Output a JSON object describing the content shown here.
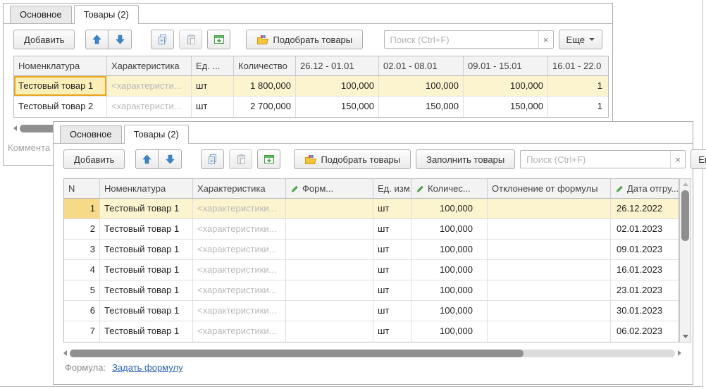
{
  "colors": {
    "selection_row": "#fcf3cf",
    "selection_focus_border": "#e9a51e",
    "selection_number_cell": "#f6da88",
    "link_blue": "#2c63b8",
    "move_arrow_blue": "#3d85c8",
    "pencil_green": "#52a852"
  },
  "back_window": {
    "tabs": [
      {
        "label": "Основное"
      },
      {
        "label": "Товары (2)"
      }
    ],
    "toolbar": {
      "add_label": "Добавить",
      "pick_label": "Подобрать товары",
      "search_placeholder": "Поиск (Ctrl+F)",
      "clear_glyph": "×",
      "more_label": "Еще"
    },
    "columns": [
      "Номенклатура",
      "Характеристика",
      "Ед. ...",
      "Количество",
      "26.12 - 01.01",
      "02.01 - 08.01",
      "09.01 - 15.01",
      "16.01 - 22.0"
    ],
    "rows": [
      {
        "name": "Тестовый товар 1",
        "characteristic": "<характеристи...",
        "unit": "шт",
        "qty": "1 800,000",
        "w1": "100,000",
        "w2": "100,000",
        "w3": "100,000",
        "w4": "1"
      },
      {
        "name": "Тестовый товар 2",
        "characteristic": "<характеристи...",
        "unit": "шт",
        "qty": "2 700,000",
        "w1": "150,000",
        "w2": "150,000",
        "w3": "150,000",
        "w4": "1"
      }
    ],
    "comment_label": "Коммента"
  },
  "front_window": {
    "tabs": [
      {
        "label": "Основное"
      },
      {
        "label": "Товары (2)"
      }
    ],
    "toolbar": {
      "add_label": "Добавить",
      "pick_label": "Подобрать товары",
      "fill_label": "Заполнить товары",
      "search_placeholder": "Поиск (Ctrl+F)",
      "clear_glyph": "×",
      "more_label": "Еще"
    },
    "columns": [
      "N",
      "Номенклатура",
      "Характеристика",
      "Форм...",
      "Ед. изм.",
      "Количес...",
      "Отклонение от формулы",
      "Дата отгру..."
    ],
    "rows": [
      {
        "n": "1",
        "name": "Тестовый товар 1",
        "characteristic": "<характеристики...",
        "formula": "",
        "unit": "шт",
        "qty": "100,000",
        "deviation": "",
        "date": "26.12.2022"
      },
      {
        "n": "2",
        "name": "Тестовый товар 1",
        "characteristic": "<характеристики...",
        "formula": "",
        "unit": "шт",
        "qty": "100,000",
        "deviation": "",
        "date": "02.01.2023"
      },
      {
        "n": "3",
        "name": "Тестовый товар 1",
        "characteristic": "<характеристики...",
        "formula": "",
        "unit": "шт",
        "qty": "100,000",
        "deviation": "",
        "date": "09.01.2023"
      },
      {
        "n": "4",
        "name": "Тестовый товар 1",
        "characteristic": "<характеристики...",
        "formula": "",
        "unit": "шт",
        "qty": "100,000",
        "deviation": "",
        "date": "16.01.2023"
      },
      {
        "n": "5",
        "name": "Тестовый товар 1",
        "characteristic": "<характеристики...",
        "formula": "",
        "unit": "шт",
        "qty": "100,000",
        "deviation": "",
        "date": "23.01.2023"
      },
      {
        "n": "6",
        "name": "Тестовый товар 1",
        "characteristic": "<характеристики...",
        "formula": "",
        "unit": "шт",
        "qty": "100,000",
        "deviation": "",
        "date": "30.01.2023"
      },
      {
        "n": "7",
        "name": "Тестовый товар 1",
        "characteristic": "<характеристики...",
        "formula": "",
        "unit": "шт",
        "qty": "100,000",
        "deviation": "",
        "date": "06.02.2023"
      }
    ],
    "footer": {
      "formula_label": "Формула:",
      "formula_link": "Задать формулу"
    }
  }
}
